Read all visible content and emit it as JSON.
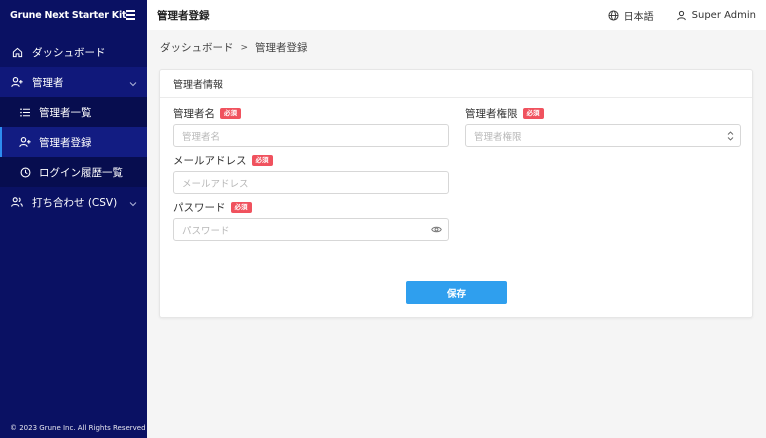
{
  "app": {
    "brand": "Grune Next Starter Kit"
  },
  "sidebar": {
    "items": [
      {
        "label": "ダッシュボード",
        "icon": "home-icon"
      },
      {
        "label": "管理者",
        "icon": "user-add-icon"
      },
      {
        "label": "管理者一覧",
        "icon": "list-icon"
      },
      {
        "label": "管理者登録",
        "icon": "user-plus-icon"
      },
      {
        "label": "ログイン履歴一覧",
        "icon": "clock-icon"
      },
      {
        "label": "打ち合わせ (CSV)",
        "icon": "users-icon"
      }
    ],
    "footer": "© 2023 Grune Inc. All Rights Reserved"
  },
  "header": {
    "title": "管理者登録",
    "language": "日本語",
    "user": "Super Admin"
  },
  "breadcrumb": {
    "home": "ダッシュボード",
    "separator": ">",
    "current": "管理者登録"
  },
  "form": {
    "section_title": "管理者情報",
    "required_badge": "必須",
    "name": {
      "label": "管理者名",
      "placeholder": "管理者名"
    },
    "role": {
      "label": "管理者権限",
      "placeholder": "管理者権限"
    },
    "email": {
      "label": "メールアドレス",
      "placeholder": "メールアドレス"
    },
    "password": {
      "label": "パスワード",
      "placeholder": "パスワード"
    },
    "save_label": "保存"
  },
  "colors": {
    "sidebar_bg": "#0a1163",
    "accent": "#2f9fee",
    "required": "#f0525e"
  }
}
